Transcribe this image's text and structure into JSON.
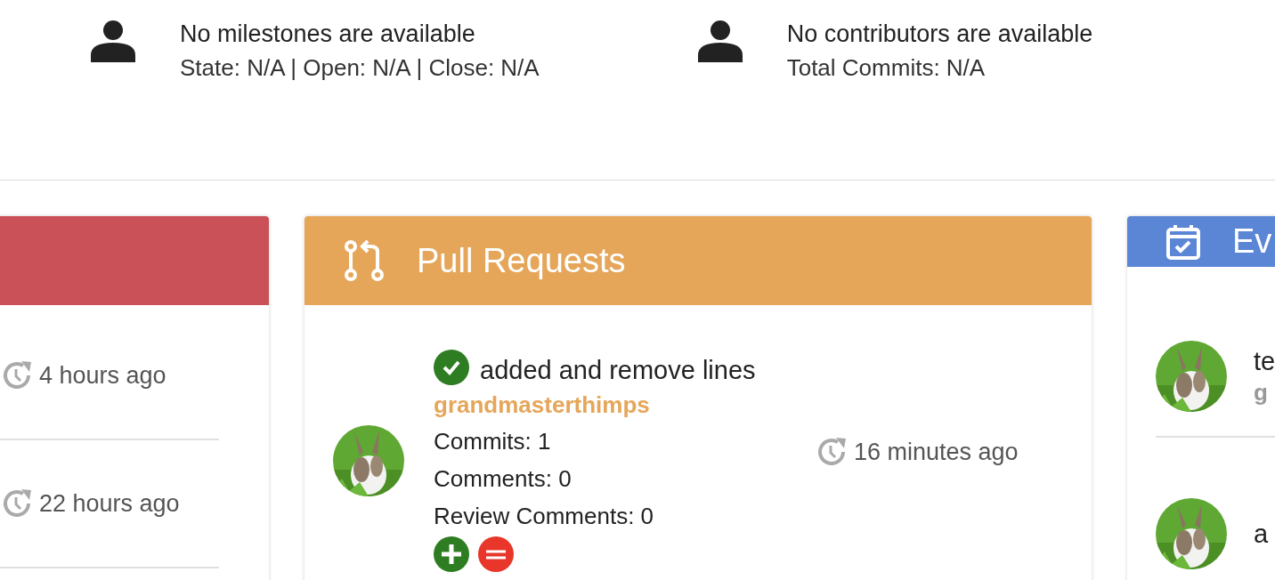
{
  "summary": [
    {
      "title": "No milestones are available",
      "detail": "State: N/A | Open: N/A | Close: N/A"
    },
    {
      "title": "No contributors are available",
      "detail": "Total Commits: N/A"
    }
  ],
  "cards": [
    {
      "kind": "list",
      "color": "#c95157",
      "items": [
        {
          "time": "4 hours ago"
        },
        {
          "time": "22 hours ago"
        }
      ]
    },
    {
      "kind": "pulls",
      "color": "#e5a65a",
      "title": "Pull Requests",
      "items": [
        {
          "title": "added and remove lines",
          "merged": true,
          "author": "grandmasterthimps",
          "stats": [
            "Commits: 1",
            "Comments: 0",
            "Review Comments: 0"
          ],
          "time": "16 minutes ago"
        }
      ]
    },
    {
      "kind": "events",
      "color": "#5a86d5",
      "title": "Ev",
      "items": [
        {
          "title": "te",
          "author": "g"
        },
        {
          "title": "a"
        }
      ]
    }
  ]
}
